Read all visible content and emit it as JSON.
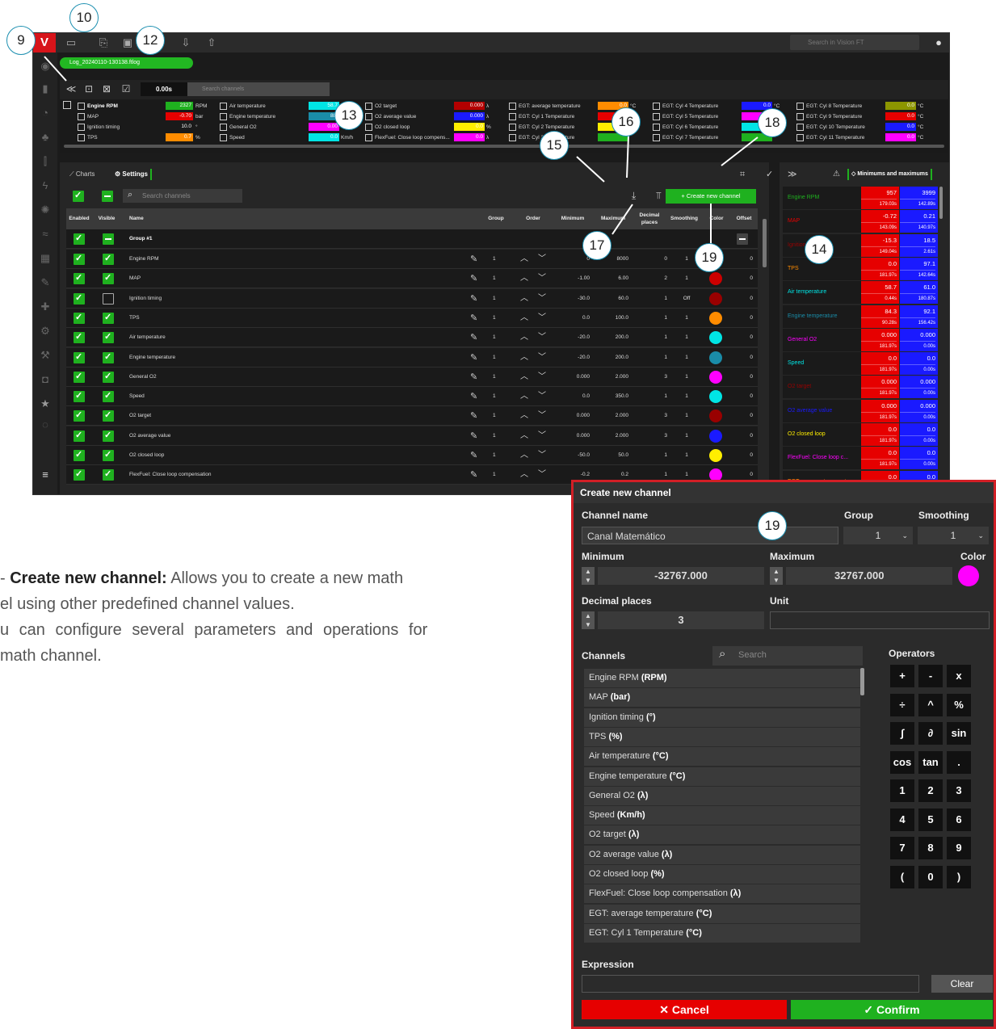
{
  "topbar": {
    "logo": "V",
    "global_search_placeholder": "Search in Vision FT",
    "file_tab": "Log_20240110-130138.ftlog"
  },
  "toolstrip": {
    "time": "0.00s",
    "search_placeholder": "Search channels"
  },
  "readouts": {
    "col1": [
      {
        "name": "Engine RPM",
        "value": "2327",
        "unit": "RPM",
        "color": "#1fb11f"
      },
      {
        "name": "MAP",
        "value": "-0.70",
        "unit": "bar",
        "color": "#e60000"
      },
      {
        "name": "Ignition timing",
        "value": "10.0",
        "unit": "°",
        "color": ""
      },
      {
        "name": "TPS",
        "value": "0.7",
        "unit": "%",
        "color": "#ff8c00"
      }
    ],
    "col2": [
      {
        "name": "Air temperature",
        "value": "58.7",
        "unit": "",
        "color": "#00e5e5"
      },
      {
        "name": "Engine temperature",
        "value": "88.",
        "unit": "",
        "color": "#1a8ca8"
      },
      {
        "name": "General O2",
        "value": "0.00",
        "unit": "",
        "color": "#ff00ff"
      },
      {
        "name": "Speed",
        "value": "0.0",
        "unit": "Km/h",
        "color": "#00e5e5"
      }
    ],
    "col3": [
      {
        "name": "O2 target",
        "value": "0.000",
        "unit": "λ",
        "color": "#b30000"
      },
      {
        "name": "O2 average value",
        "value": "0.000",
        "unit": "λ",
        "color": "#1a1aff"
      },
      {
        "name": "O2 closed loop",
        "value": "0.0",
        "unit": "%",
        "color": "#ffee00"
      },
      {
        "name": "FlexFuel: Close loop compens...",
        "value": "0.0",
        "unit": "λ",
        "color": "#ff00ff"
      }
    ],
    "col4": [
      {
        "name": "EGT: average temperature",
        "value": "0.0",
        "unit": "°C",
        "color": "#ff8c00"
      },
      {
        "name": "EGT: Cyl 1 Temperature",
        "value": "",
        "unit": "",
        "color": "#e60000"
      },
      {
        "name": "EGT: Cyl 2 Temperature",
        "value": "",
        "unit": "",
        "color": "#ffee00"
      },
      {
        "name": "EGT: Cyl 3 Temperature",
        "value": "",
        "unit": "",
        "color": "#1fb11f"
      }
    ],
    "col5": [
      {
        "name": "EGT: Cyl 4 Temperature",
        "value": "0.0",
        "unit": "°C",
        "color": "#1a1aff"
      },
      {
        "name": "EGT: Cyl 5 Temperature",
        "value": "",
        "unit": "",
        "color": "#ff00ff"
      },
      {
        "name": "EGT: Cyl 6 Temperature",
        "value": "",
        "unit": "",
        "color": "#00e5e5"
      },
      {
        "name": "EGT: Cyl 7 Temperature",
        "value": "",
        "unit": "",
        "color": "#1fb11f"
      }
    ],
    "col6": [
      {
        "name": "EGT: Cyl 8 Temperature",
        "value": "0.0",
        "unit": "°C",
        "color": "#8c9600"
      },
      {
        "name": "EGT: Cyl 9 Temperature",
        "value": "0.0",
        "unit": "°C",
        "color": "#e60000"
      },
      {
        "name": "EGT: Cyl 10 Temperature",
        "value": "0.0",
        "unit": "°C",
        "color": "#1a1aff"
      },
      {
        "name": "EGT: Cyl 11 Temperature",
        "value": "0.0",
        "unit": "°C",
        "color": "#ff00ff"
      }
    ]
  },
  "settings_panel": {
    "tab_charts": "Charts",
    "tab_settings": "Settings",
    "search_placeholder": "Search channels",
    "create_button": "Create new channel",
    "headers": {
      "enabled": "Enabled",
      "visible": "Visible",
      "name": "Name",
      "group": "Group",
      "order": "Order",
      "minimum": "Minimum",
      "maximum": "Maximum",
      "decimal": "Decimal places",
      "smoothing": "Smoothing",
      "color": "Color",
      "offset": "Offset"
    },
    "group_label": "Group #1",
    "rows": [
      {
        "name": "Engine RPM",
        "group": "1",
        "min": "0",
        "max": "8000",
        "dec": "0",
        "smooth": "1",
        "color": "#1fb11f",
        "offset": "0",
        "visible": true
      },
      {
        "name": "MAP",
        "group": "1",
        "min": "-1.00",
        "max": "6.00",
        "dec": "2",
        "smooth": "1",
        "color": "#cc0000",
        "offset": "0",
        "visible": true
      },
      {
        "name": "Ignition timing",
        "group": "1",
        "min": "-30.0",
        "max": "60.0",
        "dec": "1",
        "smooth": "Off",
        "color": "#990000",
        "offset": "0",
        "visible": false
      },
      {
        "name": "TPS",
        "group": "1",
        "min": "0.0",
        "max": "100.0",
        "dec": "1",
        "smooth": "1",
        "color": "#ff8c00",
        "offset": "0",
        "visible": true
      },
      {
        "name": "Air temperature",
        "group": "1",
        "min": "-20.0",
        "max": "200.0",
        "dec": "1",
        "smooth": "1",
        "color": "#00e5e5",
        "offset": "0",
        "visible": true
      },
      {
        "name": "Engine temperature",
        "group": "1",
        "min": "-20.0",
        "max": "200.0",
        "dec": "1",
        "smooth": "1",
        "color": "#1a8ca8",
        "offset": "0",
        "visible": true
      },
      {
        "name": "General O2",
        "group": "1",
        "min": "0.000",
        "max": "2.000",
        "dec": "3",
        "smooth": "1",
        "color": "#ff00ff",
        "offset": "0",
        "visible": true
      },
      {
        "name": "Speed",
        "group": "1",
        "min": "0.0",
        "max": "350.0",
        "dec": "1",
        "smooth": "1",
        "color": "#00e5e5",
        "offset": "0",
        "visible": true
      },
      {
        "name": "O2 target",
        "group": "1",
        "min": "0.000",
        "max": "2.000",
        "dec": "3",
        "smooth": "1",
        "color": "#990000",
        "offset": "0",
        "visible": true
      },
      {
        "name": "O2 average value",
        "group": "1",
        "min": "0.000",
        "max": "2.000",
        "dec": "3",
        "smooth": "1",
        "color": "#1a1aff",
        "offset": "0",
        "visible": true
      },
      {
        "name": "O2 closed loop",
        "group": "1",
        "min": "-50.0",
        "max": "50.0",
        "dec": "1",
        "smooth": "1",
        "color": "#ffee00",
        "offset": "0",
        "visible": true
      },
      {
        "name": "FlexFuel: Close loop compensation",
        "group": "1",
        "min": "-0.2",
        "max": "0.2",
        "dec": "1",
        "smooth": "1",
        "color": "#ff00ff",
        "offset": "0",
        "visible": true
      }
    ]
  },
  "minmax_panel": {
    "title": "Minimums and maximums",
    "rows": [
      {
        "name": "Engine RPM",
        "color": "#1fb11f",
        "min": "957",
        "min_t": "179.03s",
        "max": "3999",
        "max_t": "142.89s"
      },
      {
        "name": "MAP",
        "color": "#e60000",
        "min": "-0.72",
        "min_t": "143.09s",
        "max": "0.21",
        "max_t": "140.97s"
      },
      {
        "name": "Ignition timing",
        "color": "#990000",
        "min": "-15.3",
        "min_t": "149.04s",
        "max": "18.5",
        "max_t": "2.61s"
      },
      {
        "name": "TPS",
        "color": "#ff8c00",
        "min": "0.0",
        "min_t": "181.97s",
        "max": "97.1",
        "max_t": "142.64s"
      },
      {
        "name": "Air temperature",
        "color": "#00e5e5",
        "min": "58.7",
        "min_t": "0.44s",
        "max": "61.0",
        "max_t": "180.87s"
      },
      {
        "name": "Engine temperature",
        "color": "#1a8ca8",
        "min": "84.3",
        "min_t": "90.28s",
        "max": "92.1",
        "max_t": "156.42s"
      },
      {
        "name": "General O2",
        "color": "#ff00ff",
        "min": "0.000",
        "min_t": "181.97s",
        "max": "0.000",
        "max_t": "0.00s"
      },
      {
        "name": "Speed",
        "color": "#00e5e5",
        "min": "0.0",
        "min_t": "181.97s",
        "max": "0.0",
        "max_t": "0.00s"
      },
      {
        "name": "O2 target",
        "color": "#990000",
        "min": "0.000",
        "min_t": "181.97s",
        "max": "0.000",
        "max_t": "0.00s"
      },
      {
        "name": "O2 average value",
        "color": "#1a1aff",
        "min": "0.000",
        "min_t": "181.97s",
        "max": "0.000",
        "max_t": "0.00s"
      },
      {
        "name": "O2 closed loop",
        "color": "#ffee00",
        "min": "0.0",
        "min_t": "181.97s",
        "max": "0.0",
        "max_t": "0.00s"
      },
      {
        "name": "FlexFuel: Close loop c...",
        "color": "#ff00ff",
        "min": "0.0",
        "min_t": "181.97s",
        "max": "0.0",
        "max_t": "0.00s"
      },
      {
        "name": "EGT: average temperat...",
        "color": "#ff8c00",
        "min": "0.0",
        "min_t": "",
        "max": "0.0",
        "max_t": ""
      }
    ]
  },
  "callouts": [
    "9",
    "10",
    "12",
    "13",
    "14",
    "15",
    "16",
    "17",
    "18",
    "19",
    "19"
  ],
  "body_text": {
    "line1_prefix": "- ",
    "line1_bold": "Create new channel:",
    "line1_rest": " Allows you to create a new math",
    "line2": "el using other predefined channel values.",
    "line3": "u can configure several parameters and operations for",
    "line4": "math channel."
  },
  "dialog": {
    "title": "Create new channel",
    "channel_name_label": "Channel name",
    "channel_name_value": "Canal Matemático",
    "group_label": "Group",
    "group_value": "1",
    "smoothing_label": "Smoothing",
    "smoothing_value": "1",
    "minimum_label": "Minimum",
    "minimum_value": "-32767.000",
    "maximum_label": "Maximum",
    "maximum_value": "32767.000",
    "color_label": "Color",
    "color_value": "#ff00ff",
    "decimal_label": "Decimal places",
    "decimal_value": "3",
    "unit_label": "Unit",
    "unit_value": "",
    "channels_label": "Channels",
    "search_placeholder": "Search",
    "operators_label": "Operators",
    "channels": [
      {
        "name": "Engine RPM",
        "unit": "(RPM)"
      },
      {
        "name": "MAP",
        "unit": "(bar)"
      },
      {
        "name": "Ignition timing",
        "unit": "(°)"
      },
      {
        "name": "TPS",
        "unit": "(%)"
      },
      {
        "name": "Air temperature",
        "unit": "(°C)"
      },
      {
        "name": "Engine temperature",
        "unit": "(°C)"
      },
      {
        "name": "General O2",
        "unit": "(λ)"
      },
      {
        "name": "Speed",
        "unit": "(Km/h)"
      },
      {
        "name": "O2 target",
        "unit": "(λ)"
      },
      {
        "name": "O2 average value",
        "unit": "(λ)"
      },
      {
        "name": "O2 closed loop",
        "unit": "(%)"
      },
      {
        "name": "FlexFuel: Close loop compensation",
        "unit": "(λ)"
      },
      {
        "name": "EGT: average temperature",
        "unit": "(°C)"
      },
      {
        "name": "EGT: Cyl 1 Temperature",
        "unit": "(°C)"
      }
    ],
    "operators": [
      [
        "+",
        "-",
        "x"
      ],
      [
        "÷",
        "^",
        "%"
      ],
      [
        "∫",
        "∂",
        "sin"
      ],
      [
        "cos",
        "tan",
        "."
      ],
      [
        "1",
        "2",
        "3"
      ],
      [
        "4",
        "5",
        "6"
      ],
      [
        "7",
        "8",
        "9"
      ],
      [
        "(",
        "0",
        ")"
      ]
    ],
    "expression_label": "Expression",
    "expression_value": "",
    "clear_button": "Clear",
    "cancel_button": "Cancel",
    "confirm_button": "Confirm"
  }
}
